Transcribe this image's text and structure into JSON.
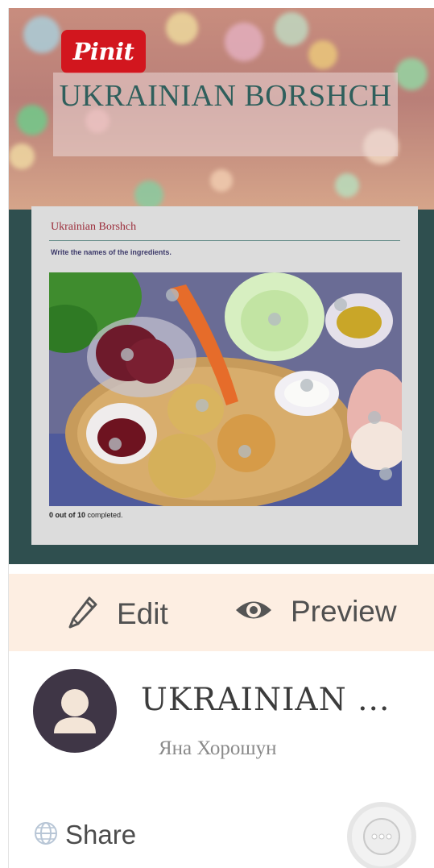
{
  "cover": {
    "pin_label": "Pinit",
    "title": "UKRAINIAN BORSHCH"
  },
  "h5p": {
    "title": "Ukrainian Borshch",
    "task": "Write the names of the ingredients.",
    "status_count": "0 out of 10",
    "status_rest": " completed."
  },
  "actions": {
    "edit_label": "Edit",
    "preview_label": "Preview"
  },
  "info": {
    "title": "UKRAINIAN ...",
    "author": "Яна Хорошун"
  },
  "footer": {
    "share_label": "Share"
  },
  "icons": {
    "pin": "pinterest-pin-it-logo",
    "edit": "pencil-icon",
    "preview": "eye-icon",
    "avatar": "user-icon",
    "share": "globe-icon",
    "more": "more-options-icon"
  },
  "colors": {
    "cover_band": "#2f4f4f",
    "pin_red": "#d2161e",
    "action_bar": "#fdeee2",
    "avatar_bg": "#3f3646",
    "h5p_title": "#9b2c3a"
  }
}
